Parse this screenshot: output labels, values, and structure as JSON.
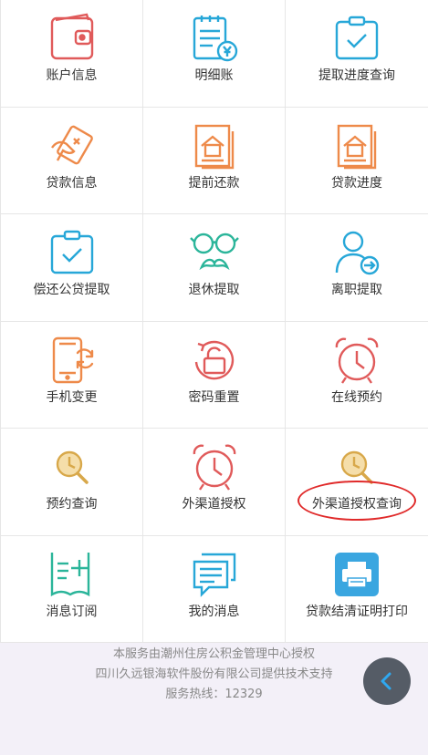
{
  "menu": {
    "items": [
      {
        "label": "账户信息",
        "icon": "wallet-icon",
        "color": "#e05a5a"
      },
      {
        "label": "明细账",
        "icon": "ledger-icon",
        "color": "#27a7d8"
      },
      {
        "label": "提取进度查询",
        "icon": "clipboard-check-icon",
        "color": "#27a7d8"
      },
      {
        "label": "贷款信息",
        "icon": "loan-card-icon",
        "color": "#ee8a4a"
      },
      {
        "label": "提前还款",
        "icon": "house-doc-icon",
        "color": "#ee8a4a"
      },
      {
        "label": "贷款进度",
        "icon": "house-doc-icon",
        "color": "#ee8a4a"
      },
      {
        "label": "偿还公贷提取",
        "icon": "clipboard-check-icon",
        "color": "#27a7d8"
      },
      {
        "label": "退休提取",
        "icon": "glasses-mustache-icon",
        "color": "#2bb59a"
      },
      {
        "label": "离职提取",
        "icon": "user-exit-icon",
        "color": "#27a7d8"
      },
      {
        "label": "手机变更",
        "icon": "phone-refresh-icon",
        "color": "#ee8a4a"
      },
      {
        "label": "密码重置",
        "icon": "unlock-icon",
        "color": "#e05a5a"
      },
      {
        "label": "在线预约",
        "icon": "alarm-clock-icon",
        "color": "#e05a5a"
      },
      {
        "label": "预约查询",
        "icon": "magnifier-icon",
        "color": "#d8a84a"
      },
      {
        "label": "外渠道授权",
        "icon": "alarm-clock-icon",
        "color": "#e05a5a"
      },
      {
        "label": "外渠道授权查询",
        "icon": "magnifier-icon",
        "color": "#d8a84a"
      },
      {
        "label": "消息订阅",
        "icon": "subscribe-list-icon",
        "color": "#2bb59a"
      },
      {
        "label": "我的消息",
        "icon": "chat-bubbles-icon",
        "color": "#27a7d8"
      },
      {
        "label": "贷款结清证明打印",
        "icon": "printer-icon",
        "color": "#3aa6e0"
      }
    ]
  },
  "footer": {
    "line1": "本服务由潮州住房公积金管理中心授权",
    "line2": "四川久远银海软件股份有限公司提供技术支持",
    "line3": "服务热线：12329"
  },
  "colors": {
    "highlight": "#e02a2a",
    "back_button": "#555c66",
    "back_arrow": "#2fa8f0"
  }
}
